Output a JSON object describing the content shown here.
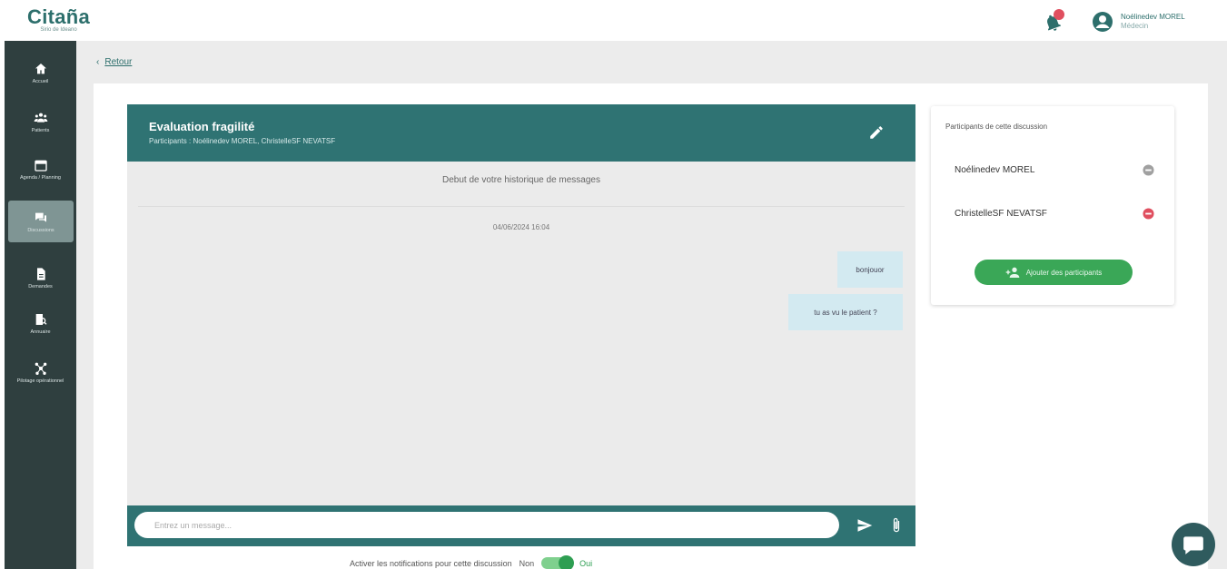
{
  "brand": {
    "name": "Citaña",
    "tagline": "Sirio de Ideano"
  },
  "header": {
    "user_name": "Noélinedev MOREL",
    "user_role": "Médecin"
  },
  "sidebar": {
    "items": [
      {
        "label": "Accueil",
        "icon": "home-icon"
      },
      {
        "label": "Patients",
        "icon": "people-icon"
      },
      {
        "label": "Agenda / Planning",
        "icon": "calendar-icon"
      },
      {
        "label": "Discussions",
        "icon": "chat-icon",
        "active": true
      },
      {
        "label": "Demandes",
        "icon": "document-icon"
      },
      {
        "label": "Annuaire",
        "icon": "directory-icon"
      },
      {
        "label": "Pilotage opérationnel",
        "icon": "network-icon"
      }
    ]
  },
  "back": {
    "label": "Retour"
  },
  "chat": {
    "title": "Evaluation fragilité",
    "participants_line": "Participants : Noélinedev MOREL, ChristelleSF NEVATSF",
    "history_start": "Debut de votre historique de messages",
    "date": "04/06/2024 16:04",
    "messages": [
      {
        "text": "bonjouor"
      },
      {
        "text": "tu as vu le patient ?"
      }
    ],
    "input_placeholder": "Entrez un message..."
  },
  "notifications": {
    "label": "Activer les notifications pour cette discussion",
    "no_label": "Non",
    "yes_label": "Oui",
    "enabled": true
  },
  "participants_panel": {
    "title": "Participants de cette discussion",
    "participants": [
      {
        "name": "Noélinedev MOREL",
        "remove_color": "#a0a0a0"
      },
      {
        "name": "ChristelleSF NEVATSF",
        "remove_color": "#e04f5f"
      }
    ],
    "add_label": "Ajouter des participants"
  },
  "colors": {
    "primary": "#2f7373",
    "sidebar": "#2f3f3f",
    "success": "#3aa757",
    "danger": "#e04f5f"
  }
}
